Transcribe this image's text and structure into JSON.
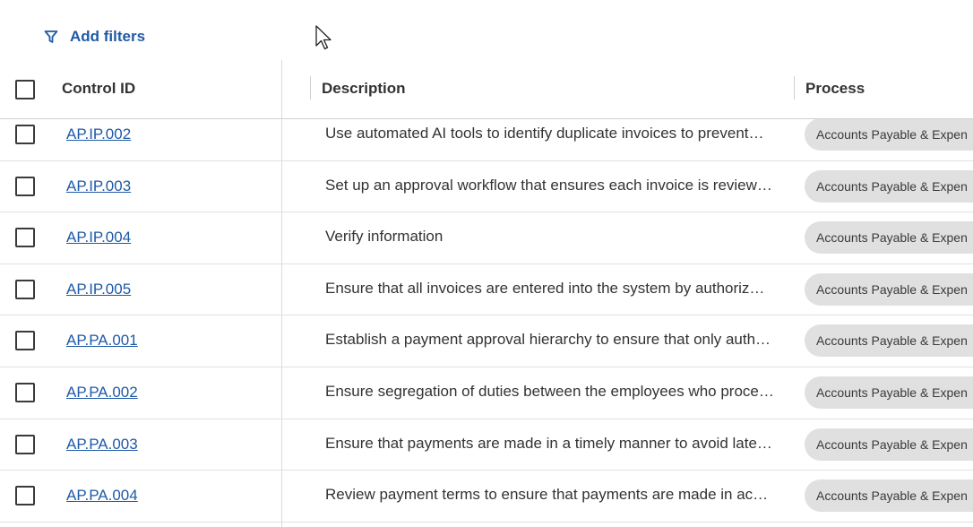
{
  "toolbar": {
    "add_filters_label": "Add filters",
    "filter_icon": "filter-icon"
  },
  "table": {
    "columns": [
      "Control ID",
      "Description",
      "Process"
    ],
    "rows": [
      {
        "id": "AP.IP.002",
        "description": "Use automated AI tools to identify duplicate invoices to prevent…",
        "process": "Accounts Payable & Expen"
      },
      {
        "id": "AP.IP.003",
        "description": "Set up an approval workflow that ensures each invoice is review…",
        "process": "Accounts Payable & Expen"
      },
      {
        "id": "AP.IP.004",
        "description": "Verify information",
        "process": "Accounts Payable & Expen"
      },
      {
        "id": "AP.IP.005",
        "description": "Ensure that all invoices are entered into the system by authoriz…",
        "process": "Accounts Payable & Expen"
      },
      {
        "id": "AP.PA.001",
        "description": "Establish a payment approval hierarchy to ensure that only auth…",
        "process": "Accounts Payable & Expen"
      },
      {
        "id": "AP.PA.002",
        "description": "Ensure segregation of duties between the employees who proce…",
        "process": "Accounts Payable & Expen"
      },
      {
        "id": "AP.PA.003",
        "description": "Ensure that payments are made in a timely manner to avoid late…",
        "process": "Accounts Payable & Expen"
      },
      {
        "id": "AP.PA.004",
        "description": "Review payment terms to ensure that payments are made in ac…",
        "process": "Accounts Payable & Expen"
      }
    ]
  },
  "colors": {
    "link": "#1f5aa6",
    "pill_bg": "#e0e0e0"
  }
}
